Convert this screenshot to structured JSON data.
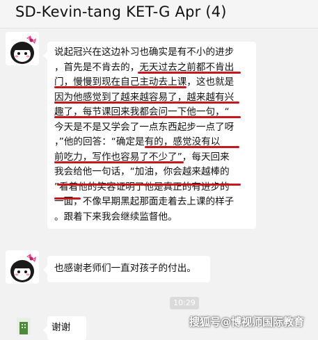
{
  "chat": {
    "title": "SD-Kevin-tang KET-G Apr (4)"
  },
  "messages": [
    {
      "text_lines": [
        "说起冠兴在这边补习也确实是有不小的进步",
        "，首先是不肯去的，无天过去之前都不肯出",
        "门，慢慢到现在自己主动去上课，这也就是",
        "因为他感觉到了越来越容易了，越来越有兴",
        "趣了，每节课回来我都会问一下他一句，“",
        "今天是不是又学会了一点东西起步一点了呀",
        "，”他的回答：“确定是有的，感觉没有以",
        "前吃力，写作也容易了不少了”，每天回来",
        "我会给他一句话，“加油，你会越来越棒的",
        "”看着他的笑容证明了他是真正的有进步的",
        "一面，不像早期黑起那面走着去上课的样子",
        "。跟着下来我会继续监督他。"
      ]
    },
    {
      "text": "也感谢老师们一直对孩子的付出。"
    },
    {
      "text": "谢谢"
    }
  ],
  "timestamp": "10:29",
  "watermark": "搜狐号@博视师国际教育",
  "colors": {
    "underline": "#c5171c",
    "background": "#f2f2f2",
    "bubble": "#ffffff"
  },
  "icons": [
    "avatar-icon",
    "group-avatar-icon"
  ]
}
